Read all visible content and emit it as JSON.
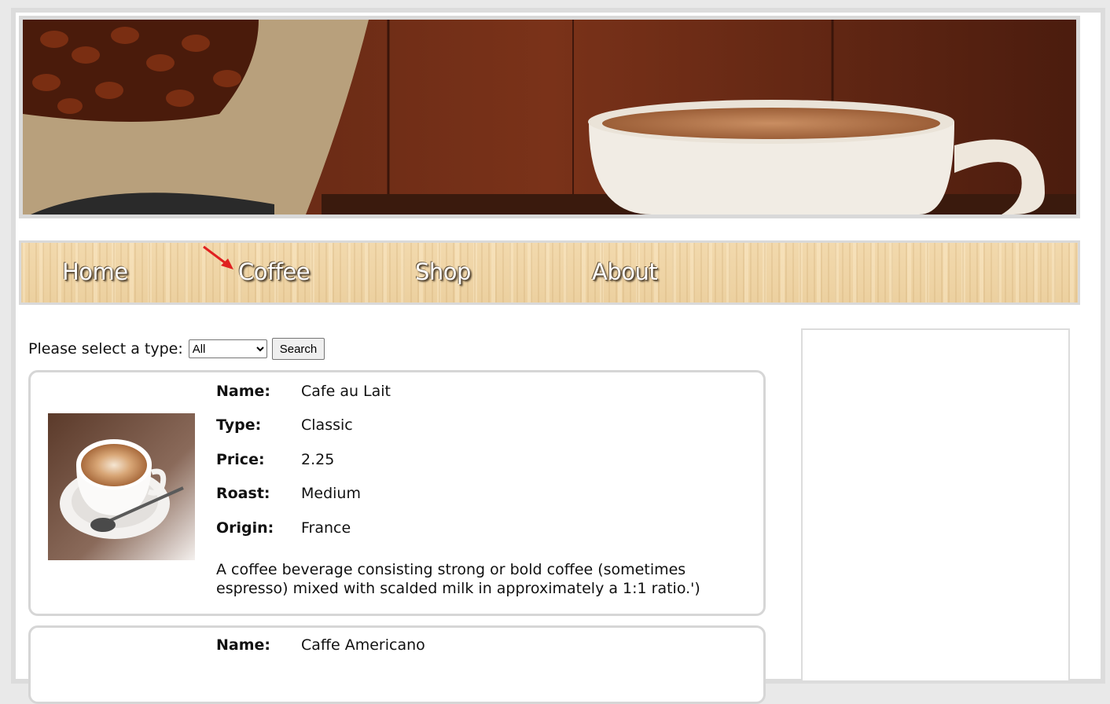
{
  "nav": {
    "items": [
      {
        "label": "Home"
      },
      {
        "label": "Coffee"
      },
      {
        "label": "Shop"
      },
      {
        "label": "About"
      }
    ]
  },
  "filter": {
    "label": "Please select a type:",
    "selected": "All",
    "button": "Search"
  },
  "labels": {
    "name": "Name:",
    "type": "Type:",
    "price": "Price:",
    "roast": "Roast:",
    "origin": "Origin:"
  },
  "products": [
    {
      "name": "Cafe au Lait",
      "type": "Classic",
      "price": "2.25",
      "roast": "Medium",
      "origin": "France",
      "description": "A coffee beverage consisting strong or bold coffee (sometimes espresso) mixed with scalded milk in approximately a 1:1 ratio.')"
    },
    {
      "name": "Caffe Americano"
    }
  ],
  "icons": {
    "annotation": "red-arrow-icon"
  },
  "colors": {
    "nav_text": "#ffffff",
    "arrow": "#e02020",
    "card_border": "#d6d6d6"
  }
}
